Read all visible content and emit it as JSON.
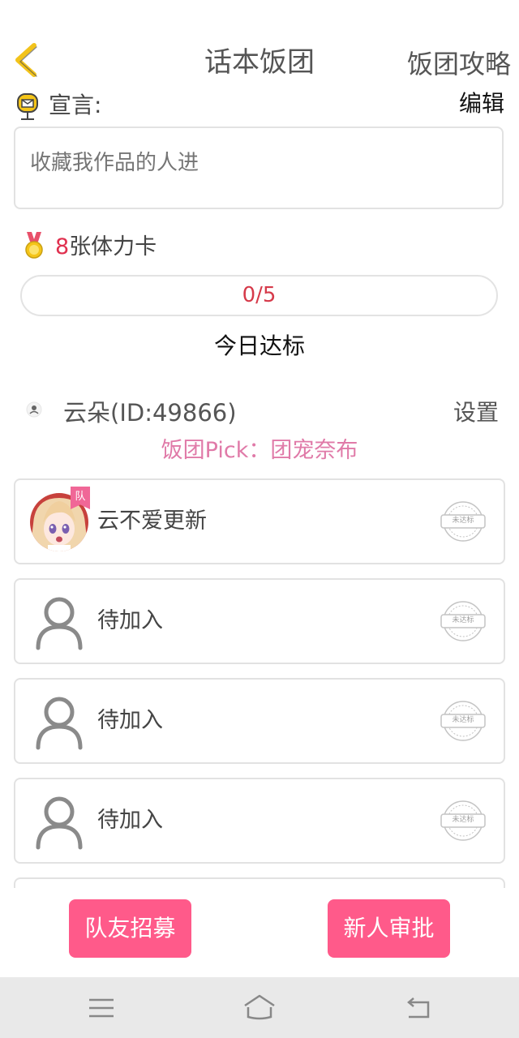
{
  "header": {
    "title": "话本饭团",
    "right_link": "饭团攻略"
  },
  "declaration": {
    "label": "宣言:",
    "edit_label": "编辑",
    "placeholder": "收藏我作品的人进"
  },
  "stamina": {
    "count": "8",
    "suffix": "张体力卡"
  },
  "progress": {
    "text": "0/5",
    "fraction": 0,
    "caption": "今日达标"
  },
  "leader": {
    "name": "云朵(ID:49866)",
    "settings_label": "设置",
    "pick_text": "饭团Pick：团宠奈布"
  },
  "members": [
    {
      "name": "云不爱更新",
      "has_photo": true,
      "tag": "队",
      "status": "未达标"
    },
    {
      "name": "待加入",
      "has_photo": false,
      "tag": "",
      "status": "未达标"
    },
    {
      "name": "待加入",
      "has_photo": false,
      "tag": "",
      "status": "未达标"
    },
    {
      "name": "待加入",
      "has_photo": false,
      "tag": "",
      "status": "未达标"
    }
  ],
  "actions": {
    "recruit_label": "队友招募",
    "approve_label": "新人审批"
  },
  "colors": {
    "accent": "#ff5a8a",
    "pick": "#e07aa8",
    "count": "#e0304f",
    "back_arrow": "#f2c31b"
  },
  "icons": {
    "back": "chevron-left-icon",
    "declaration": "mailbox-icon",
    "stamina": "medal-icon",
    "empty_member": "user-outline-icon",
    "status": "stamp-icon"
  }
}
